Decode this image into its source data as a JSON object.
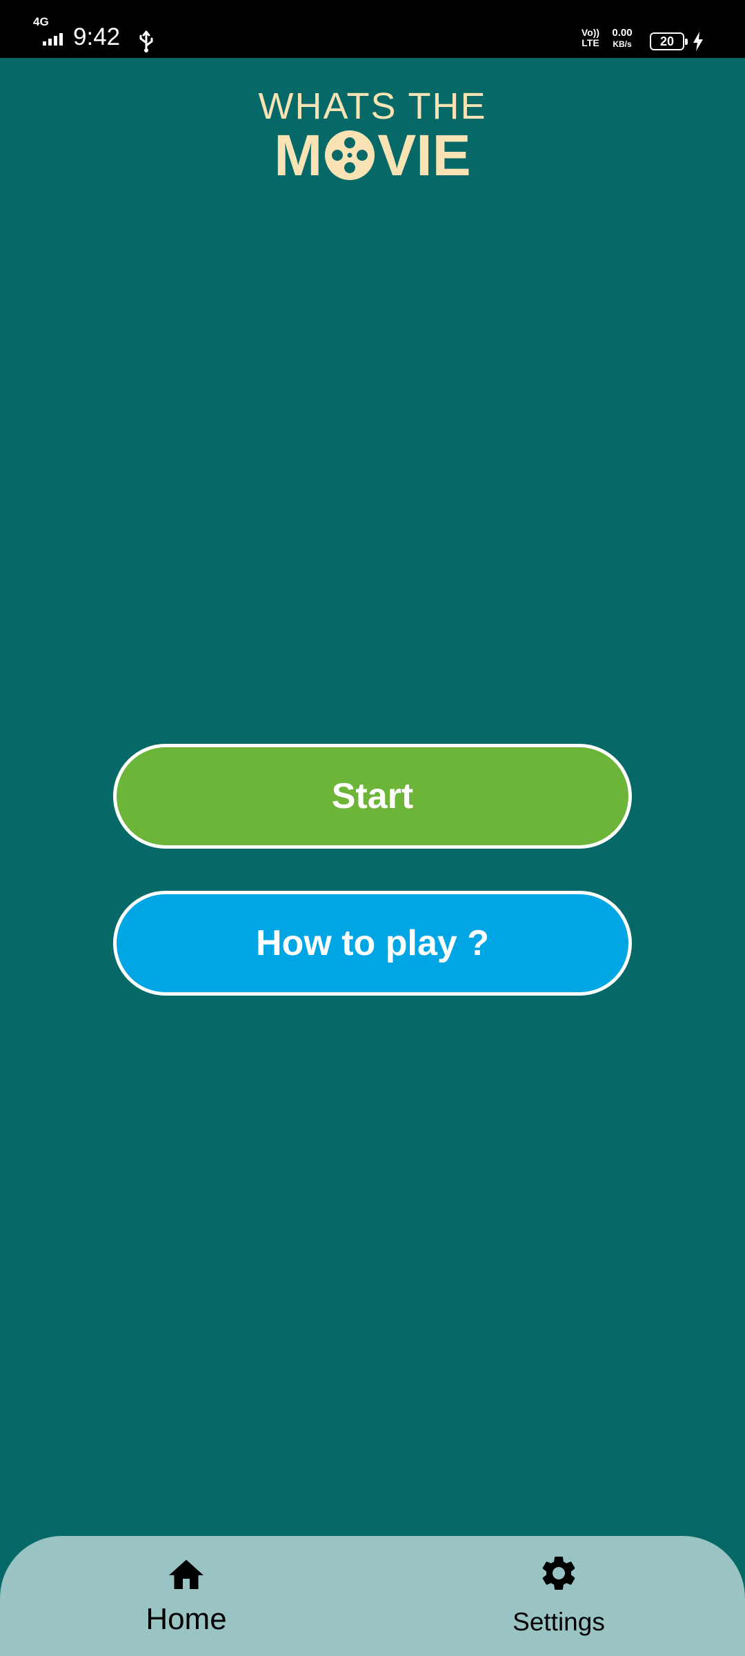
{
  "status_bar": {
    "network": "4G",
    "time": "9:42",
    "volte_top": "Vo))",
    "volte_bottom": "LTE",
    "speed_value": "0.00",
    "speed_unit": "KB/s",
    "battery_level": "20",
    "icons": [
      "signal-icon",
      "usb-icon",
      "battery-icon",
      "charging-icon"
    ]
  },
  "logo": {
    "line1": "WHATS THE",
    "line2_left": "M",
    "line2_right": "VIE",
    "icon": "film-reel-icon",
    "color": "#f9e3b4"
  },
  "actions": {
    "start_label": "Start",
    "howto_label": "How to play ?"
  },
  "bottom_nav": {
    "items": [
      {
        "label": "Home",
        "icon": "home-icon"
      },
      {
        "label": "Settings",
        "icon": "gear-icon"
      }
    ]
  },
  "colors": {
    "background": "#066967",
    "start_button": "#6cb538",
    "howto_button": "#00a5e4",
    "nav_background": "#9ac4c4"
  }
}
